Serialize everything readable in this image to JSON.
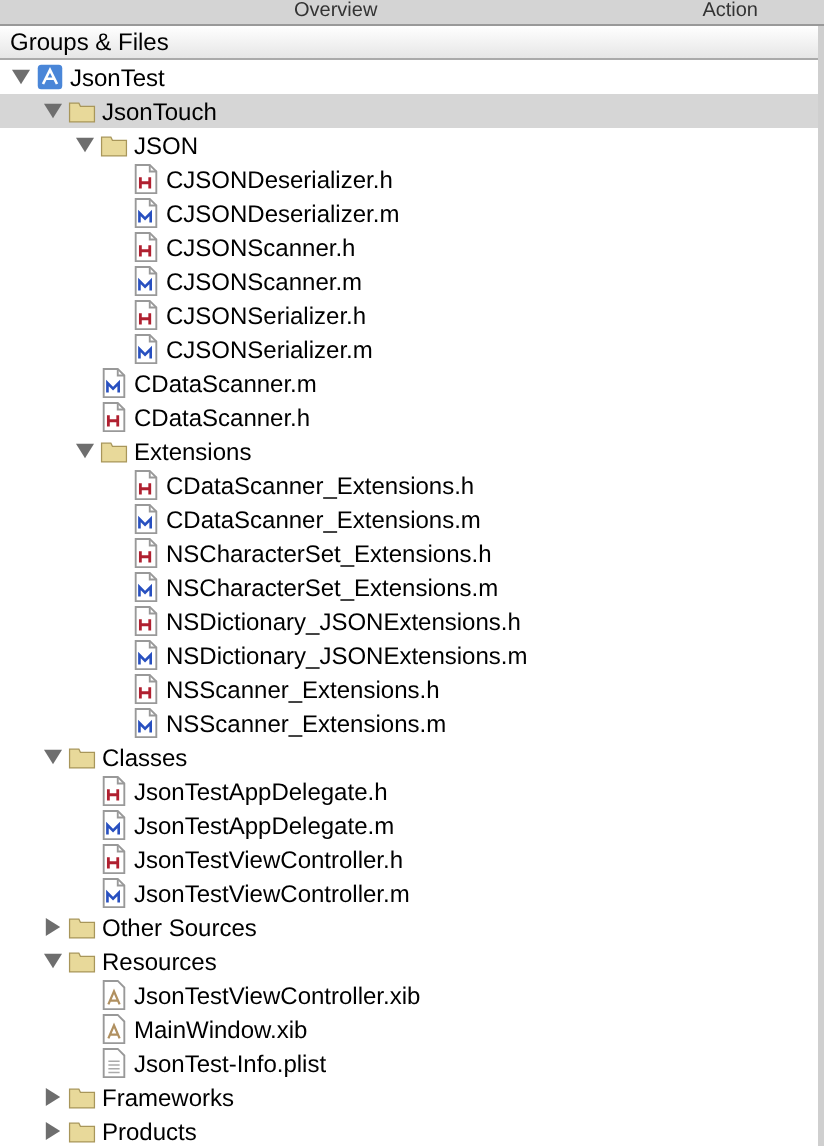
{
  "toolbar": {
    "columns": [
      "Overview",
      "Action"
    ]
  },
  "panel": {
    "title": "Groups & Files"
  },
  "tree": [
    {
      "label": "JsonTest",
      "kind": "project",
      "expanded": true,
      "selected": false,
      "children": [
        {
          "label": "JsonTouch",
          "kind": "folder",
          "expanded": true,
          "selected": true,
          "children": [
            {
              "label": "JSON",
              "kind": "folder",
              "expanded": true,
              "selected": false,
              "children": [
                {
                  "label": "CJSONDeserializer.h",
                  "kind": "header",
                  "selected": false
                },
                {
                  "label": "CJSONDeserializer.m",
                  "kind": "source",
                  "selected": false
                },
                {
                  "label": "CJSONScanner.h",
                  "kind": "header",
                  "selected": false
                },
                {
                  "label": "CJSONScanner.m",
                  "kind": "source",
                  "selected": false
                },
                {
                  "label": "CJSONSerializer.h",
                  "kind": "header",
                  "selected": false
                },
                {
                  "label": "CJSONSerializer.m",
                  "kind": "source",
                  "selected": false
                }
              ]
            },
            {
              "label": "CDataScanner.m",
              "kind": "source",
              "selected": false
            },
            {
              "label": "CDataScanner.h",
              "kind": "header",
              "selected": false
            },
            {
              "label": "Extensions",
              "kind": "folder",
              "expanded": true,
              "selected": false,
              "children": [
                {
                  "label": "CDataScanner_Extensions.h",
                  "kind": "header",
                  "selected": false
                },
                {
                  "label": "CDataScanner_Extensions.m",
                  "kind": "source",
                  "selected": false
                },
                {
                  "label": "NSCharacterSet_Extensions.h",
                  "kind": "header",
                  "selected": false
                },
                {
                  "label": "NSCharacterSet_Extensions.m",
                  "kind": "source",
                  "selected": false
                },
                {
                  "label": "NSDictionary_JSONExtensions.h",
                  "kind": "header",
                  "selected": false
                },
                {
                  "label": "NSDictionary_JSONExtensions.m",
                  "kind": "source",
                  "selected": false
                },
                {
                  "label": "NSScanner_Extensions.h",
                  "kind": "header",
                  "selected": false
                },
                {
                  "label": "NSScanner_Extensions.m",
                  "kind": "source",
                  "selected": false
                }
              ]
            }
          ]
        },
        {
          "label": "Classes",
          "kind": "folder",
          "expanded": true,
          "selected": false,
          "children": [
            {
              "label": "JsonTestAppDelegate.h",
              "kind": "header",
              "selected": false
            },
            {
              "label": "JsonTestAppDelegate.m",
              "kind": "source",
              "selected": false
            },
            {
              "label": "JsonTestViewController.h",
              "kind": "header",
              "selected": false
            },
            {
              "label": "JsonTestViewController.m",
              "kind": "source",
              "selected": false
            }
          ]
        },
        {
          "label": "Other Sources",
          "kind": "folder",
          "expanded": false,
          "selected": false
        },
        {
          "label": "Resources",
          "kind": "folder",
          "expanded": true,
          "selected": false,
          "children": [
            {
              "label": "JsonTestViewController.xib",
              "kind": "interface",
              "selected": false
            },
            {
              "label": "MainWindow.xib",
              "kind": "interface",
              "selected": false
            },
            {
              "label": "JsonTest-Info.plist",
              "kind": "plist",
              "selected": false
            }
          ]
        },
        {
          "label": "Frameworks",
          "kind": "folder",
          "expanded": false,
          "selected": false
        },
        {
          "label": "Products",
          "kind": "folder",
          "expanded": false,
          "selected": false
        }
      ]
    }
  ]
}
